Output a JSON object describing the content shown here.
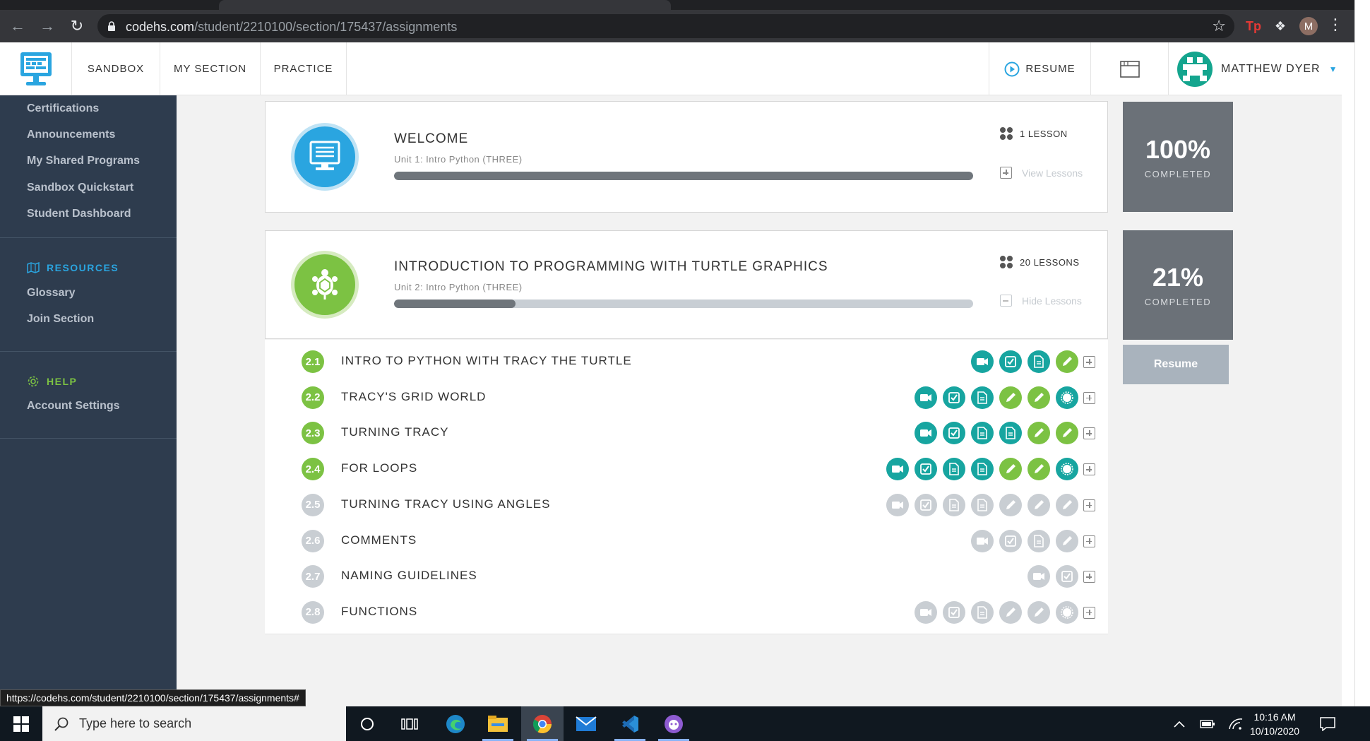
{
  "browser": {
    "url_host": "codehs.com",
    "url_path": "/student/2210100/section/175437/assignments",
    "profile_initial": "M",
    "ext_tp": "Tp"
  },
  "header": {
    "nav": [
      "SANDBOX",
      "MY SECTION",
      "PRACTICE"
    ],
    "resume_label": "RESUME",
    "user_name": "MATTHEW DYER"
  },
  "sidebar": {
    "top_items": [
      "Certifications",
      "Announcements",
      "My Shared Programs",
      "Sandbox Quickstart",
      "Student Dashboard"
    ],
    "resources_heading": "RESOURCES",
    "resources_items": [
      "Glossary",
      "Join Section"
    ],
    "help_heading": "HELP",
    "help_items": [
      "Account Settings"
    ]
  },
  "units": [
    {
      "title": "WELCOME",
      "subtitle": "Unit 1: Intro Python (THREE)",
      "lesson_count": "1 LESSON",
      "toggle_label": "View Lessons",
      "progress": 1.0,
      "percent": "100%",
      "completed_label": "COMPLETED"
    },
    {
      "title": "INTRODUCTION TO PROGRAMMING WITH TURTLE GRAPHICS",
      "subtitle": "Unit 2: Intro Python (THREE)",
      "lesson_count": "20 LESSONS",
      "toggle_label": "Hide Lessons",
      "progress": 0.21,
      "percent": "21%",
      "completed_label": "COMPLETED",
      "resume_label": "Resume"
    }
  ],
  "lessons": [
    {
      "num": "2.1",
      "title": "INTRO TO PYTHON WITH TRACY THE TURTLE",
      "done": true,
      "activities": [
        "video",
        "check",
        "doc",
        "pencil"
      ]
    },
    {
      "num": "2.2",
      "title": "TRACY'S GRID WORLD",
      "done": true,
      "activities": [
        "video",
        "check",
        "doc",
        "pencil",
        "pencil",
        "badge"
      ]
    },
    {
      "num": "2.3",
      "title": "TURNING TRACY",
      "done": true,
      "activities": [
        "video",
        "check",
        "doc",
        "doc",
        "pencil",
        "pencil"
      ]
    },
    {
      "num": "2.4",
      "title": "FOR LOOPS",
      "done": true,
      "activities": [
        "video",
        "check",
        "doc",
        "doc",
        "pencil",
        "pencil",
        "badge"
      ]
    },
    {
      "num": "2.5",
      "title": "TURNING TRACY USING ANGLES",
      "done": false,
      "activities": [
        "video",
        "check",
        "doc",
        "doc",
        "pencil",
        "pencil",
        "pencil"
      ]
    },
    {
      "num": "2.6",
      "title": "COMMENTS",
      "done": false,
      "activities": [
        "video",
        "check",
        "doc",
        "pencil"
      ]
    },
    {
      "num": "2.7",
      "title": "NAMING GUIDELINES",
      "done": false,
      "activities": [
        "video",
        "check"
      ]
    },
    {
      "num": "2.8",
      "title": "FUNCTIONS",
      "done": false,
      "activities": [
        "video",
        "check",
        "doc",
        "pencil",
        "pencil",
        "badge"
      ]
    }
  ],
  "status_url": "https://codehs.com/student/2210100/section/175437/assignments#",
  "taskbar": {
    "search_placeholder": "Type here to search",
    "time": "10:16 AM",
    "date": "10/10/2020"
  },
  "colors": {
    "teal": "#17a5a0",
    "green": "#7cc243",
    "inactive": "#c9ced3",
    "sidebar": "#2e3c4e",
    "accent_blue": "#2aa5e0",
    "help_green": "#7cc243"
  }
}
